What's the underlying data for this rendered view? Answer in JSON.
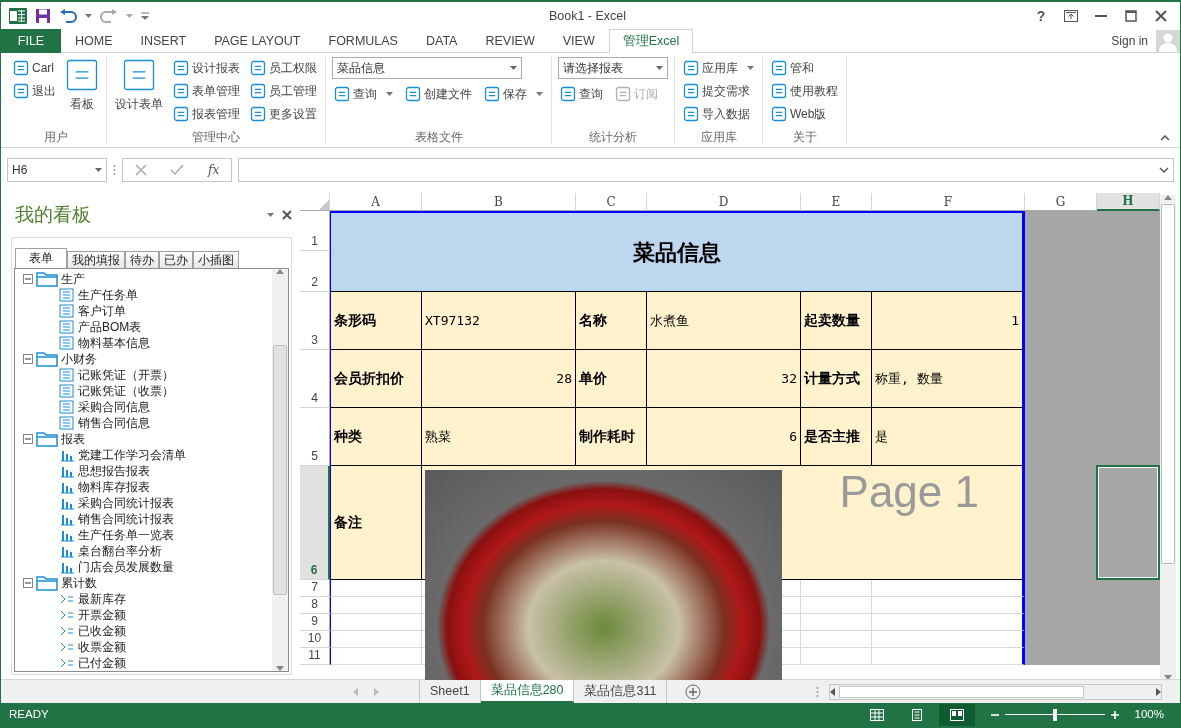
{
  "window": {
    "title": "Book1 - Excel",
    "help": "?"
  },
  "ribbon_tabs": [
    {
      "label": "FILE",
      "kind": "file",
      "selected": false
    },
    {
      "label": "HOME",
      "kind": "tab",
      "selected": false
    },
    {
      "label": "INSERT",
      "kind": "tab",
      "selected": false
    },
    {
      "label": "PAGE LAYOUT",
      "kind": "tab",
      "selected": false
    },
    {
      "label": "FORMULAS",
      "kind": "tab",
      "selected": false
    },
    {
      "label": "DATA",
      "kind": "tab",
      "selected": false
    },
    {
      "label": "REVIEW",
      "kind": "tab",
      "selected": false
    },
    {
      "label": "VIEW",
      "kind": "tab",
      "selected": false
    },
    {
      "label": "管理Excel",
      "kind": "tab",
      "selected": true
    }
  ],
  "sign_in": "Sign in",
  "ribbon_groups": [
    {
      "label": "用户",
      "kind": "columns",
      "columns": [
        [
          {
            "label": "Carl",
            "kind": "small"
          },
          {
            "label": "退出",
            "kind": "small"
          }
        ],
        [
          {
            "label": "看板",
            "kind": "large"
          }
        ]
      ]
    },
    {
      "label": "管理中心",
      "kind": "columns",
      "columns": [
        [
          {
            "label": "设计表单",
            "kind": "large"
          }
        ],
        [
          {
            "label": "设计报表",
            "kind": "small"
          },
          {
            "label": "表单管理",
            "kind": "small"
          },
          {
            "label": "报表管理",
            "kind": "small"
          }
        ],
        [
          {
            "label": "员工权限",
            "kind": "small"
          },
          {
            "label": "员工管理",
            "kind": "small"
          },
          {
            "label": "更多设置",
            "kind": "small"
          }
        ]
      ]
    },
    {
      "label": "表格文件",
      "kind": "stack",
      "lines": [
        [
          {
            "label": "菜品信息",
            "kind": "dropdown"
          }
        ],
        [
          {
            "label": "查询",
            "kind": "small",
            "caret": true
          },
          {
            "label": "创建文件",
            "kind": "small"
          },
          {
            "label": "保存",
            "kind": "small",
            "caret": true
          }
        ]
      ]
    },
    {
      "label": "统计分析",
      "kind": "stack",
      "lines": [
        [
          {
            "label": "请选择报表",
            "kind": "dropdown"
          }
        ],
        [
          {
            "label": "查询",
            "kind": "small"
          },
          {
            "label": "订阅",
            "kind": "small",
            "disabled": true
          }
        ]
      ]
    },
    {
      "label": "应用库",
      "kind": "columns",
      "columns": [
        [
          {
            "label": "应用库",
            "kind": "small",
            "caret": true
          },
          {
            "label": "提交需求",
            "kind": "small"
          },
          {
            "label": "导入数据",
            "kind": "small"
          }
        ]
      ]
    },
    {
      "label": "关于",
      "kind": "columns",
      "columns": [
        [
          {
            "label": "管和",
            "kind": "small"
          },
          {
            "label": "使用教程",
            "kind": "small"
          },
          {
            "label": "Web版",
            "kind": "small"
          }
        ]
      ]
    }
  ],
  "formula_bar": {
    "name_box": "H6",
    "fx": "fx"
  },
  "task_pane": {
    "title": "我的看板",
    "tabs": [
      {
        "label": "表单",
        "selected": true
      },
      {
        "label": "我的填报",
        "selected": false
      },
      {
        "label": "待办",
        "selected": false
      },
      {
        "label": "已办",
        "selected": false
      },
      {
        "label": "小插图",
        "selected": false
      }
    ],
    "tree": [
      {
        "label": "生产",
        "expanded": true,
        "children": [
          {
            "label": "生产任务单",
            "kind": "form"
          },
          {
            "label": "客户订单",
            "kind": "form"
          },
          {
            "label": "产品BOM表",
            "kind": "form"
          },
          {
            "label": "物料基本信息",
            "kind": "form"
          }
        ]
      },
      {
        "label": "小财务",
        "expanded": true,
        "children": [
          {
            "label": "记账凭证（开票）",
            "kind": "form"
          },
          {
            "label": "记账凭证（收票）",
            "kind": "form"
          },
          {
            "label": "采购合同信息",
            "kind": "form"
          },
          {
            "label": "销售合同信息",
            "kind": "form"
          }
        ]
      },
      {
        "label": "报表",
        "expanded": true,
        "children": [
          {
            "label": "党建工作学习会清单",
            "kind": "report"
          },
          {
            "label": "思想报告报表",
            "kind": "report"
          },
          {
            "label": "物料库存报表",
            "kind": "report"
          },
          {
            "label": "采购合同统计报表",
            "kind": "report"
          },
          {
            "label": "销售合同统计报表",
            "kind": "report"
          },
          {
            "label": "生产任务单一览表",
            "kind": "report"
          },
          {
            "label": "桌台翻台率分析",
            "kind": "report"
          },
          {
            "label": "门店会员发展数量",
            "kind": "report"
          }
        ]
      },
      {
        "label": "累计数",
        "expanded": true,
        "children": [
          {
            "label": "最新库存",
            "kind": "stat"
          },
          {
            "label": "开票金额",
            "kind": "stat"
          },
          {
            "label": "已收金额",
            "kind": "stat"
          },
          {
            "label": "收票金额",
            "kind": "stat"
          },
          {
            "label": "已付金额",
            "kind": "stat"
          }
        ]
      }
    ]
  },
  "sheet": {
    "columns": [
      {
        "label": "A",
        "selected": false
      },
      {
        "label": "B",
        "selected": false
      },
      {
        "label": "C",
        "selected": false
      },
      {
        "label": "D",
        "selected": false
      },
      {
        "label": "E",
        "selected": false
      },
      {
        "label": "F",
        "selected": false
      },
      {
        "label": "G",
        "selected": false
      },
      {
        "label": "H",
        "selected": true
      }
    ],
    "rows": [
      {
        "label": "1",
        "selected": false
      },
      {
        "label": "2",
        "selected": false
      },
      {
        "label": "3",
        "selected": false
      },
      {
        "label": "4",
        "selected": false
      },
      {
        "label": "5",
        "selected": false
      },
      {
        "label": "6",
        "selected": true
      },
      {
        "label": "7",
        "selected": false
      },
      {
        "label": "8",
        "selected": false
      },
      {
        "label": "9",
        "selected": false
      },
      {
        "label": "10",
        "selected": false
      },
      {
        "label": "11",
        "selected": false
      }
    ],
    "title": "菜品信息",
    "fields": [
      [
        {
          "label": "条形码",
          "value": "XT97132",
          "right_aligned": false
        },
        {
          "label": "名称",
          "value": "水煮鱼",
          "right_aligned": false
        },
        {
          "label": "起卖数量",
          "value": "1",
          "right_aligned": true
        }
      ],
      [
        {
          "label": "会员折扣价",
          "value": "28",
          "right_aligned": true
        },
        {
          "label": "单价",
          "value": "32",
          "right_aligned": true
        },
        {
          "label": "计量方式",
          "value": "称重, 数量",
          "right_aligned": false
        }
      ],
      [
        {
          "label": "种类",
          "value": "熟菜",
          "right_aligned": false
        },
        {
          "label": "制作耗时",
          "value": "6",
          "right_aligned": true
        },
        {
          "label": "是否主推",
          "value": "是",
          "right_aligned": false
        }
      ]
    ],
    "notes_label": "备注",
    "page_label": "Page 1"
  },
  "sheet_tabs": [
    {
      "label": "Sheet1",
      "selected": false
    },
    {
      "label": "菜品信息280",
      "selected": true
    },
    {
      "label": "菜品信息311",
      "selected": false
    }
  ],
  "status_bar": {
    "text": "READY",
    "views": [
      {
        "kind": "normal",
        "selected": false
      },
      {
        "kind": "page_layout",
        "selected": false
      },
      {
        "kind": "page_break",
        "selected": true
      }
    ],
    "zoom": {
      "level": 0.5
    },
    "zoom_text": "100%"
  }
}
